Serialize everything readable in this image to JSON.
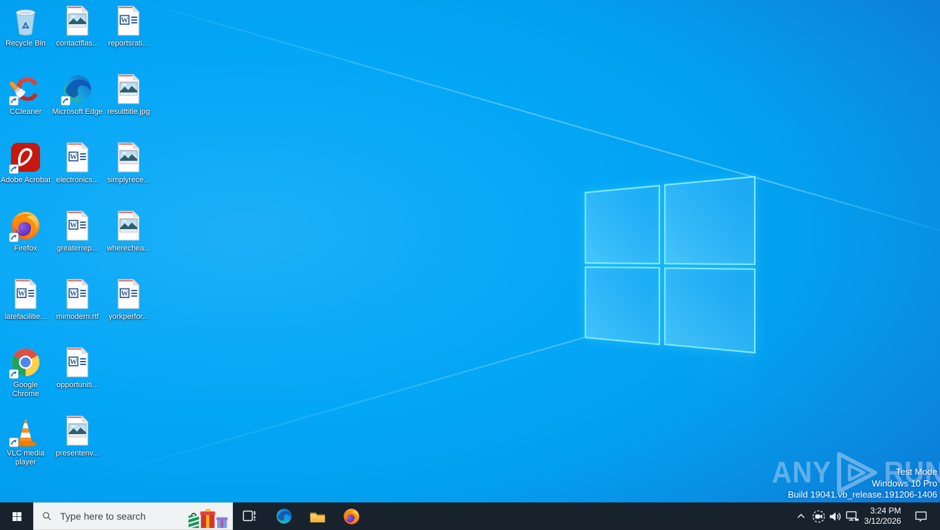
{
  "desktop_icons": [
    {
      "label": "Recycle Bin",
      "type": "recycle-bin",
      "shortcut": false
    },
    {
      "label": "contactflas...",
      "type": "image-file",
      "shortcut": false
    },
    {
      "label": "reportsrati...",
      "type": "word-document",
      "shortcut": false
    },
    {
      "label": "CCleaner",
      "type": "app-ccleaner",
      "shortcut": true
    },
    {
      "label": "Microsoft Edge",
      "type": "app-edge",
      "shortcut": true
    },
    {
      "label": "resulttitle.jpg",
      "type": "image-file",
      "shortcut": false
    },
    {
      "label": "Adobe Acrobat",
      "type": "app-adobe-acrobat",
      "shortcut": true
    },
    {
      "label": "electronics...",
      "type": "word-document",
      "shortcut": false
    },
    {
      "label": "simplyrece...",
      "type": "image-file",
      "shortcut": false
    },
    {
      "label": "Firefox",
      "type": "app-firefox",
      "shortcut": true
    },
    {
      "label": "greaterrep...",
      "type": "word-document",
      "shortcut": false
    },
    {
      "label": "wherechea...",
      "type": "image-file",
      "shortcut": false
    },
    {
      "label": "latefacilitie...",
      "type": "word-document",
      "shortcut": false
    },
    {
      "label": "mimodern.rtf",
      "type": "word-document",
      "shortcut": false
    },
    {
      "label": "yorkperfor...",
      "type": "word-document",
      "shortcut": false
    },
    {
      "label": "Google Chrome",
      "type": "app-chrome",
      "shortcut": true
    },
    {
      "label": "opportuniti...",
      "type": "word-document",
      "shortcut": false
    },
    {
      "label": "VLC media player",
      "type": "app-vlc",
      "shortcut": true
    },
    {
      "label": "presentenv...",
      "type": "image-file",
      "shortcut": false
    }
  ],
  "watermark": {
    "brand_left": "ANY",
    "brand_right": "RUN"
  },
  "system_info": {
    "mode": "Test Mode",
    "edition": "Windows 10 Pro",
    "build": "Build 19041.vb_release.191206-1406"
  },
  "taskbar": {
    "search_placeholder": "Type here to search",
    "clock": {
      "time": "3:24 PM",
      "date": "3/12/2026"
    }
  },
  "colors": {
    "wallpaper_azure": "#04a6f6",
    "wallpaper_royal": "#1c4dbe",
    "taskbar": "#17222d",
    "logo_edge": "#7beaff",
    "search_box": "#f1f2f3"
  }
}
